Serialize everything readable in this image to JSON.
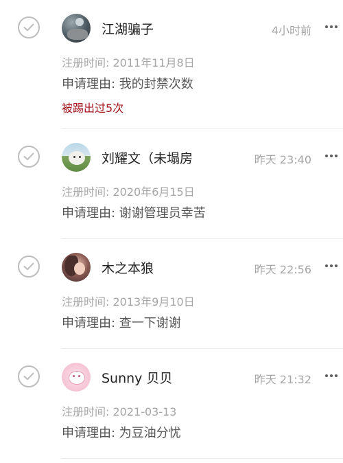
{
  "requests": [
    {
      "name": "江湖骗子",
      "time": "4小时前",
      "registered": "注册时间: 2011年11月8日",
      "reason": "申请理由: 我的封禁次数",
      "note": "被踢出过5次",
      "avatar_icon": "user-avatar"
    },
    {
      "name": "刘耀文（未塌房",
      "time": "昨天 23:40",
      "registered": "注册时间: 2020年6月15日",
      "reason": "申请理由: 谢谢管理员幸苦",
      "avatar_icon": "user-avatar"
    },
    {
      "name": "木之本狼",
      "time": "昨天 22:56",
      "registered": "注册时间: 2013年9月10日",
      "reason": "申请理由: 查一下谢谢",
      "avatar_icon": "user-avatar"
    },
    {
      "name": "Sunny 贝贝",
      "time": "昨天 21:32",
      "registered": "注册时间: 2021-03-13",
      "reason": "申请理由: 为豆油分忧",
      "avatar_icon": "user-avatar"
    }
  ],
  "colors": {
    "note": "#a3141b",
    "muted": "#a6a6a6",
    "text": "#222222"
  },
  "icons": {
    "select": "check-circle-icon",
    "more": "more-dots-icon"
  }
}
